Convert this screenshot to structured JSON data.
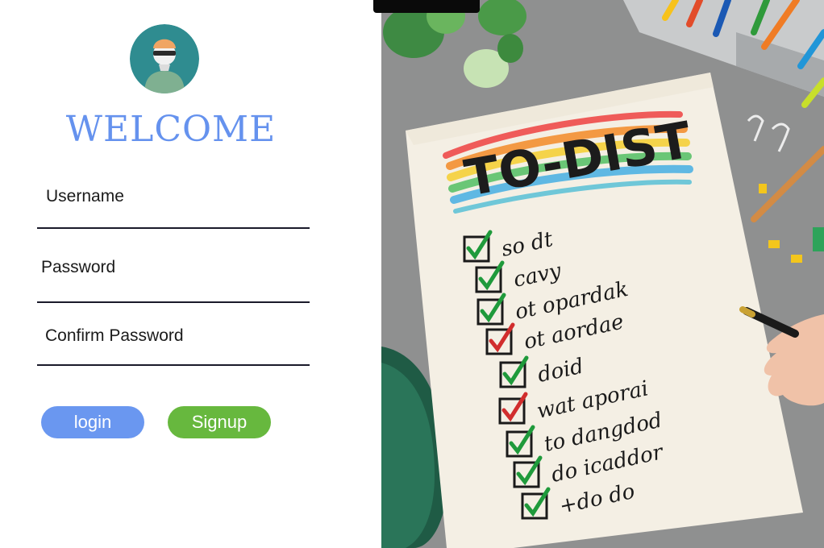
{
  "form": {
    "title": "WELCOME",
    "fields": [
      {
        "label": "Username"
      },
      {
        "label": "Password"
      },
      {
        "label": "Confirm Password"
      }
    ],
    "buttons": {
      "login": "login",
      "signup": "Signup"
    }
  },
  "notebook": {
    "title": "TO-DIST",
    "items": [
      "so dt",
      "cavy",
      "ot opardak",
      "ot aordae",
      "doid",
      "wat aporai",
      "to dangdod",
      "do icaddor",
      "+do do"
    ]
  },
  "colors": {
    "accent": "#6592ee",
    "login_bg": "#6a97f0",
    "signup_bg": "#67b83e"
  },
  "icons": {
    "avatar": "user-avatar-icon"
  }
}
